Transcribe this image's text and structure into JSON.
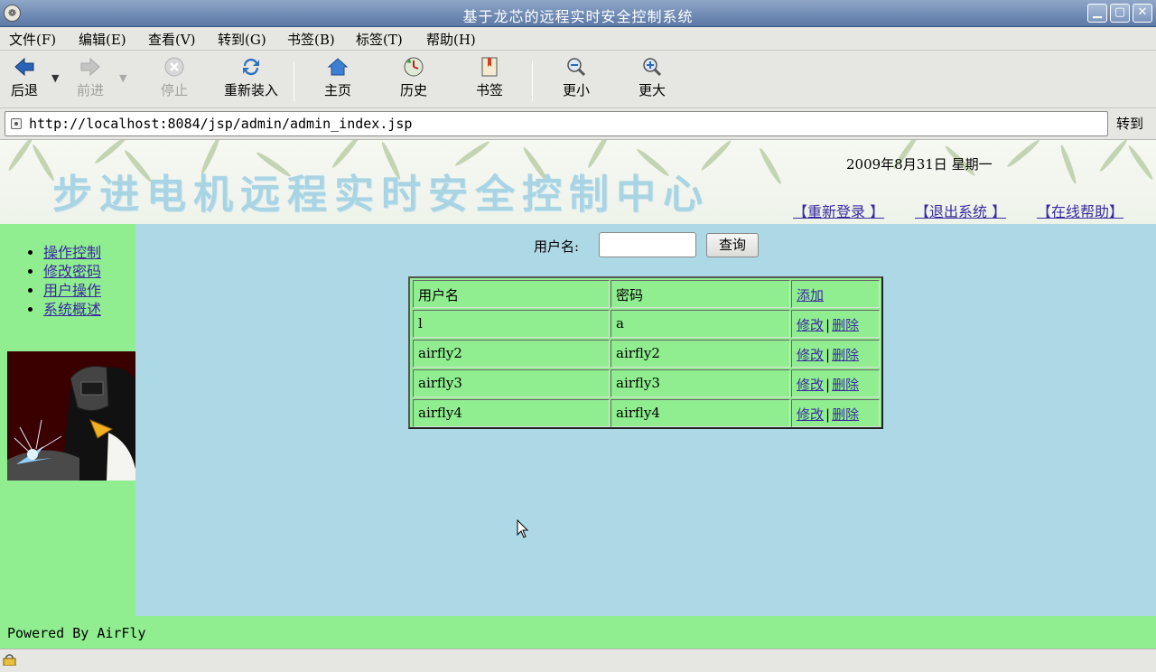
{
  "window": {
    "title": "基于龙芯的远程实时安全控制系统"
  },
  "menu": [
    "文件(F)",
    "编辑(E)",
    "查看(V)",
    "转到(G)",
    "书签(B)",
    "标签(T)",
    "帮助(H)"
  ],
  "toolbar": {
    "back": "后退",
    "forward": "前进",
    "stop": "停止",
    "reload": "重新装入",
    "home": "主页",
    "history": "历史",
    "bookmarks": "书签",
    "smaller": "更小",
    "larger": "更大"
  },
  "address": {
    "url": "http://localhost:8084/jsp/admin/admin_index.jsp",
    "go": "转到"
  },
  "banner": {
    "title": "步进电机远程实时安全控制中心",
    "date": "2009年8月31日 星期一",
    "links": [
      "【重新登录 】",
      "【退出系统 】",
      "【在线帮助】"
    ]
  },
  "sidebar": {
    "items": [
      "操作控制",
      "修改密码",
      "用户操作",
      "系统概述"
    ]
  },
  "search": {
    "label": "用户名:",
    "button": "查询",
    "value": ""
  },
  "table": {
    "headers": [
      "用户名",
      "密码",
      "添加"
    ],
    "rows": [
      {
        "user": "l",
        "password": "a",
        "edit": "修改",
        "sep": "|",
        "delete": "删除"
      },
      {
        "user": "airfly2",
        "password": "airfly2",
        "edit": "修改",
        "sep": "|",
        "delete": "删除"
      },
      {
        "user": "airfly3",
        "password": "airfly3",
        "edit": "修改",
        "sep": "|",
        "delete": "删除"
      },
      {
        "user": "airfly4",
        "password": "airfly4",
        "edit": "修改",
        "sep": "|",
        "delete": "删除"
      }
    ]
  },
  "footer": {
    "text": "Powered By AirFly"
  },
  "colors": {
    "sidebar": "#90ee90",
    "content": "#add8e6",
    "link": "#3a2aa0",
    "titlebar": "#6f8ab3"
  }
}
